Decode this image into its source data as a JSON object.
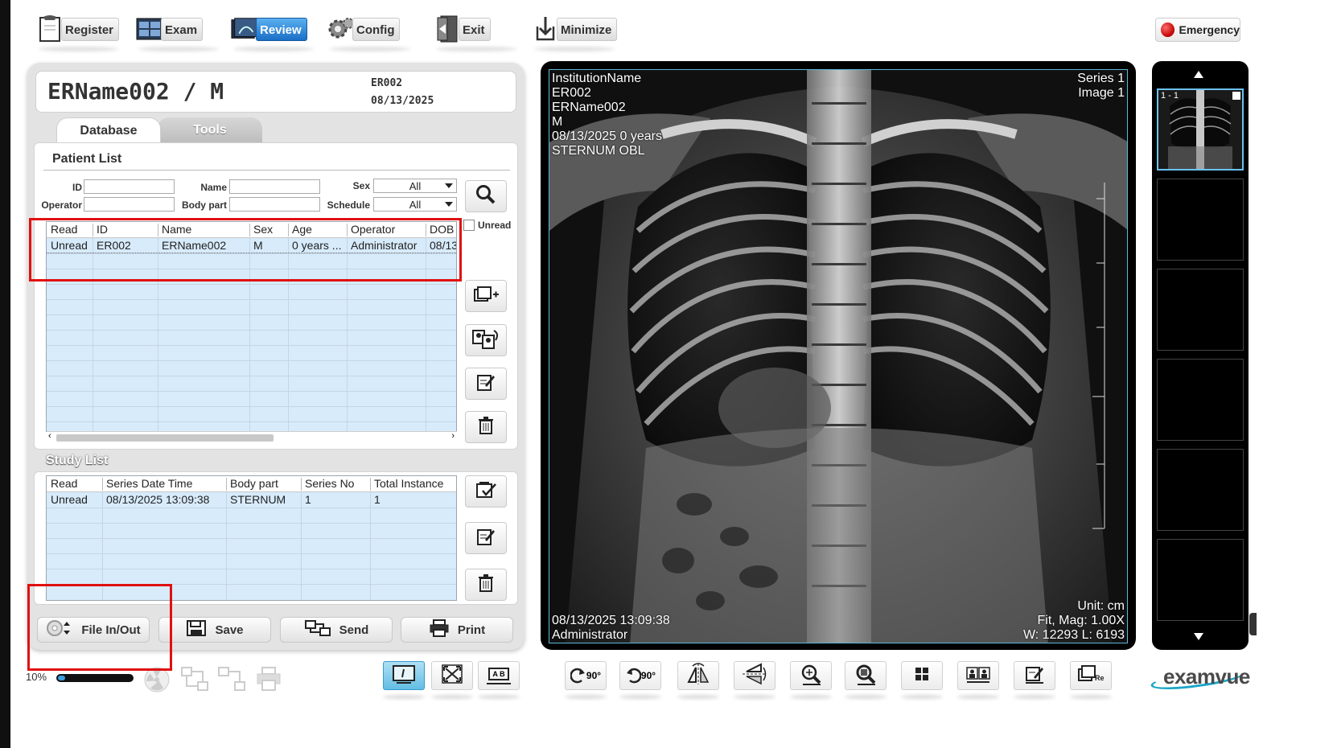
{
  "toolbar": {
    "register": "Register",
    "exam": "Exam",
    "review": "Review",
    "config": "Config",
    "exit": "Exit",
    "minimize": "Minimize"
  },
  "emergency": "Emergency",
  "patient": {
    "title": "ERName002 / M",
    "id": "ER002",
    "date": "08/13/2025"
  },
  "tabs": {
    "database": "Database",
    "tools": "Tools"
  },
  "patient_list": {
    "title": "Patient List",
    "filters": {
      "id_label": "ID",
      "name_label": "Name",
      "sex_label": "Sex",
      "sex_value": "All",
      "operator_label": "Operator",
      "bodypart_label": "Body part",
      "schedule_label": "Schedule",
      "schedule_value": "All"
    },
    "unread_label": "Unread",
    "columns": [
      "Read",
      "ID",
      "Name",
      "Sex",
      "Age",
      "Operator",
      "DOB"
    ],
    "rows": [
      [
        "Unread",
        "ER002",
        "ERName002",
        "M",
        "0 years ...",
        "Administrator",
        "08/13"
      ]
    ]
  },
  "study_list": {
    "title": "Study List",
    "columns": [
      "Read",
      "Series Date Time",
      "Body part",
      "Series No",
      "Total Instance"
    ],
    "rows": [
      [
        "Unread",
        "08/13/2025 13:09:38",
        "STERNUM",
        "1",
        "1"
      ]
    ]
  },
  "bottom_buttons": {
    "file": "File In/Out",
    "save": "Save",
    "send": "Send",
    "print": "Print"
  },
  "progress": {
    "text": "10%",
    "value": 0.1
  },
  "viewer": {
    "tl": [
      "InstitutionName",
      "ER002",
      "ERName002",
      "M",
      "08/13/2025 0 years",
      "STERNUM OBL"
    ],
    "tr": [
      "Series 1",
      "Image 1"
    ],
    "bl": [
      "08/13/2025 13:09:38",
      "Administrator"
    ],
    "br": [
      "Unit:  cm",
      "Fit, Mag: 1.00X",
      "W: 12293 L: 6193"
    ]
  },
  "thumbnail": {
    "label": "1 - 1"
  },
  "bottom_tools": {
    "rotate_cw": "90°",
    "rotate_ccw": "90°",
    "compare_ab": "A B"
  },
  "logo": "examvue",
  "colors": {
    "accent": "#1b6fc6",
    "highlight_box": "#e01010",
    "grid_bg": "#d7ebfb",
    "viewer_border": "#5fb7d6"
  }
}
